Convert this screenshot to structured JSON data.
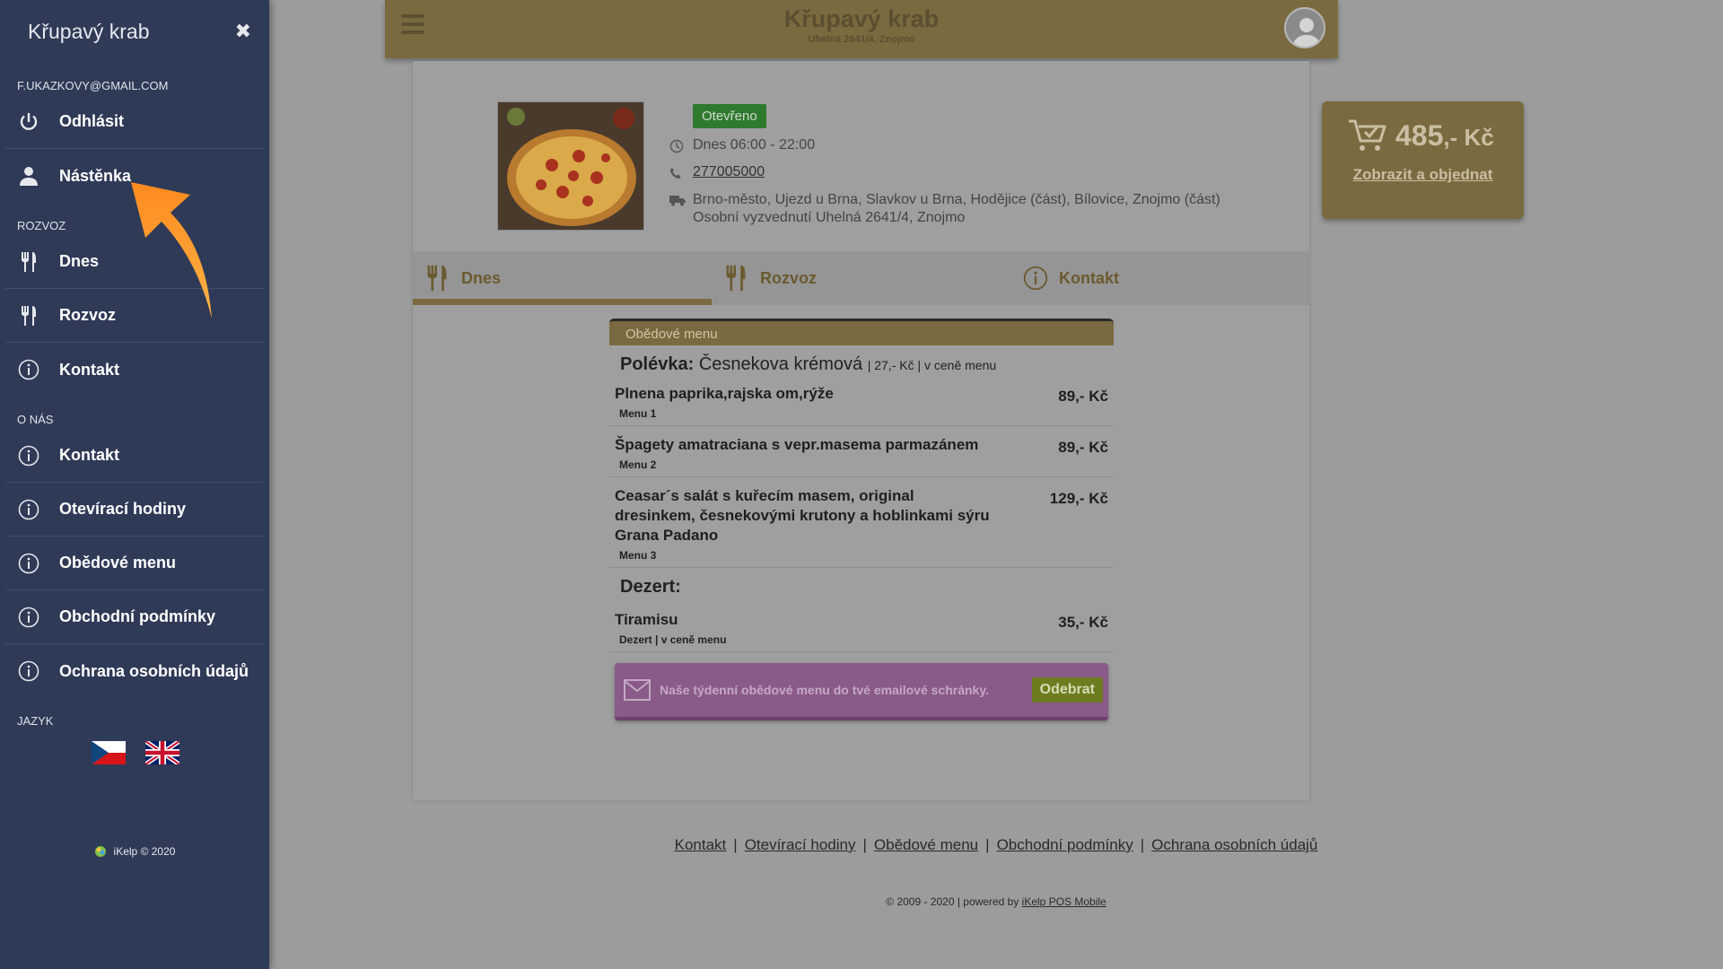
{
  "sidebar": {
    "title": "Křupavý krab",
    "close_icon": "close-icon",
    "user_email": "F.UKAZKOVY@GMAIL.COM",
    "logout_label": "Odhlásit",
    "dashboard_label": "Nástěnka",
    "section_delivery": "ROZVOZ",
    "item_today": "Dnes",
    "item_delivery": "Rozvoz",
    "item_contact": "Kontakt",
    "section_about": "O NÁS",
    "about_contact": "Kontakt",
    "about_hours": "Otevírací hodiny",
    "about_lunch": "Obědové menu",
    "about_terms": "Obchodní podmínky",
    "about_privacy": "Ochrana osobních údajů",
    "section_language": "JAZYK",
    "footer": "iKelp © 2020"
  },
  "header": {
    "name": "Křupavý krab",
    "address": "Uhelná 2641/4, Znojmo"
  },
  "restaurant": {
    "status": "Otevřeno",
    "hours": "Dnes 06:00 - 22:00",
    "phone": "277005000",
    "delivery_areas": "Brno-město, Ujezd u Brna, Slavkov u Brna, Hodějice (část), Bílovice, Znojmo (část)",
    "pickup": "Osobní vyzvednutí Uhelná 2641/4, Znojmo"
  },
  "tabs": {
    "today": "Dnes",
    "delivery": "Rozvoz",
    "contact": "Kontakt"
  },
  "menu": {
    "header": "Obědové menu",
    "soup_label": "Polévka:",
    "soup_name": "Česnekova krémová",
    "soup_meta": "| 27,- Kč | v ceně menu",
    "dishes": [
      {
        "name": "Plnena paprika,rajska om,rýže",
        "sub": "Menu 1",
        "price": "89,- Kč"
      },
      {
        "name": "Špagety amatraciana s vepr.masema parmazánem",
        "sub": "Menu 2",
        "price": "89,- Kč"
      },
      {
        "name": "Ceasar´s salát s kuřecím masem, original dresinkem, česnekovými krutony a hoblinkami sýru Grana Padano",
        "sub": "Menu 3",
        "price": "129,- Kč"
      }
    ],
    "dessert_label": "Dezert:",
    "dessert": {
      "name": "Tiramisu",
      "sub": "Dezert | v ceně menu",
      "price": "35,- Kč"
    },
    "newsletter_text": "Naše týdenní obědové menu do tvé emailové schránky.",
    "newsletter_button": "Odebrat"
  },
  "cart": {
    "total": "485",
    "currency": ",- Kč",
    "link": "Zobrazit a objednat"
  },
  "footer": {
    "links": [
      "Kontakt",
      "Otevírací hodiny",
      "Obědové menu",
      "Obchodní podmínky",
      "Ochrana osobních údajů"
    ],
    "copyright_prefix": "© 2009 - 2020 | powered by",
    "copyright_link": "iKelp POS Mobile"
  }
}
